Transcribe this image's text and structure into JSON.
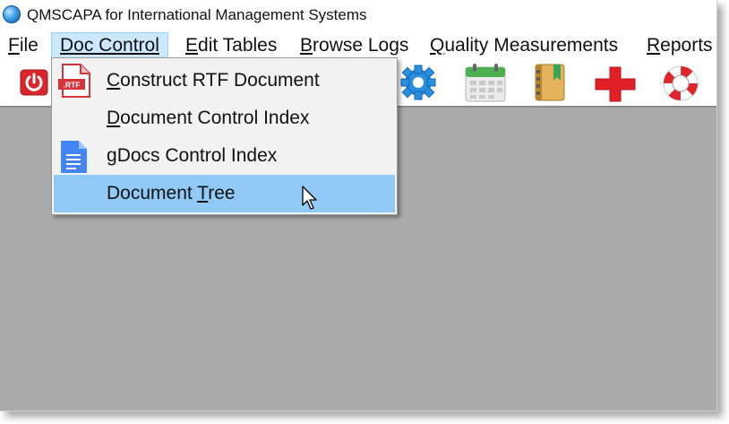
{
  "window": {
    "title": "QMSCAPA for International Management Systems",
    "icon": "globe-icon"
  },
  "menubar": {
    "items": [
      {
        "key": "F",
        "rest": "ile"
      },
      {
        "key": "D",
        "rest": "oc Control"
      },
      {
        "key": "E",
        "rest": "dit Tables"
      },
      {
        "key": "B",
        "rest": "rowse Logs"
      },
      {
        "key": "Q",
        "rest": "uality Measurements"
      },
      {
        "key": "R",
        "rest": "eports"
      }
    ],
    "open_item": "Doc Control"
  },
  "toolbar": {
    "icons": [
      "power-icon",
      "settings-gear-icon",
      "calendar-icon",
      "address-book-icon",
      "red-cross-icon",
      "lifebuoy-icon"
    ]
  },
  "dropdown": {
    "rtf_badge": ".RTF",
    "items": [
      {
        "pre": "",
        "key": "C",
        "rest": "onstruct RTF Document",
        "icon": "rtf-document-icon",
        "highlighted": false
      },
      {
        "pre": "",
        "key": "D",
        "rest": "ocument Control Index",
        "icon": "",
        "highlighted": false
      },
      {
        "pre": "",
        "key": "g",
        "rest": "Docs Control Index",
        "icon": "google-docs-icon",
        "highlighted": false
      },
      {
        "pre": "Document ",
        "key": "T",
        "rest": "ree",
        "icon": "",
        "highlighted": true
      }
    ]
  },
  "colors": {
    "workspace": "#ababab",
    "menu_open_bg": "#cce8ff",
    "dropdown_highlight": "#91c9f7",
    "dropdown_bg": "#f2f2f2"
  }
}
